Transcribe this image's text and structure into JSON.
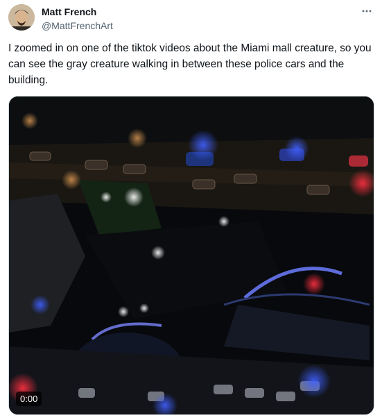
{
  "author": {
    "display_name": "Matt French",
    "handle": "@MattFrenchArt"
  },
  "tweet": {
    "text": "I zoomed in on one of the tiktok videos about the Miami mall creature, so you can see the gray creature walking in between these police cars and the building."
  },
  "video": {
    "timestamp": "0:00"
  },
  "icons": {
    "more": "more-options-icon"
  }
}
